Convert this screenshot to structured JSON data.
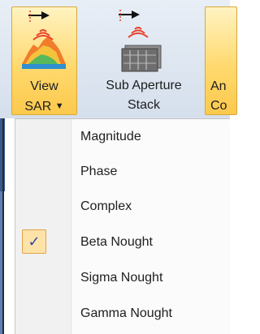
{
  "ribbon": {
    "view_sar": {
      "line1": "View",
      "line2": "SAR",
      "caret": "▼",
      "icon": "view-sar-icon"
    },
    "sub_aperture": {
      "line1": "Sub Aperture",
      "line2": "Stack",
      "icon": "sub-aperture-stack-icon"
    },
    "next": {
      "line1": "An",
      "line2": "Co"
    }
  },
  "menu": {
    "items": [
      {
        "label": "Magnitude"
      },
      {
        "label": "Phase"
      },
      {
        "label": "Complex"
      },
      {
        "label": "Beta Nought",
        "check": "✓"
      },
      {
        "label": "Sigma Nought"
      },
      {
        "label": "Gamma Nought"
      }
    ]
  }
}
